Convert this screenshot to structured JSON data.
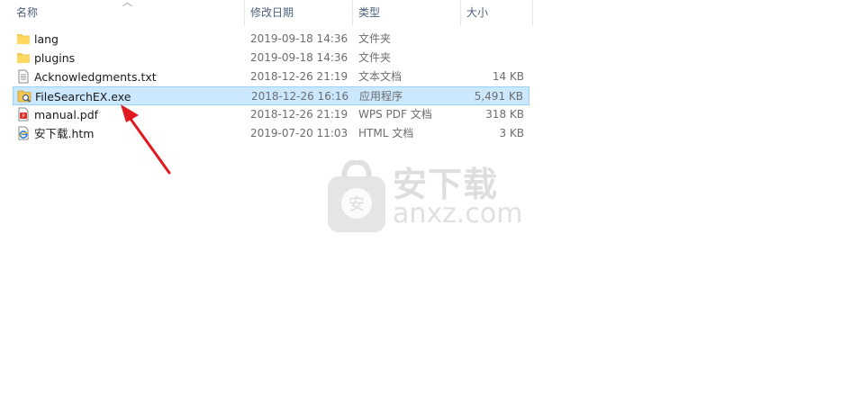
{
  "columns": {
    "name": "名称",
    "date": "修改日期",
    "type": "类型",
    "size": "大小"
  },
  "files": [
    {
      "name": "lang",
      "date": "2019-09-18 14:36",
      "type": "文件夹",
      "size": "",
      "icon": "folder-icon"
    },
    {
      "name": "plugins",
      "date": "2019-09-18 14:36",
      "type": "文件夹",
      "size": "",
      "icon": "folder-icon"
    },
    {
      "name": "Acknowledgments.txt",
      "date": "2018-12-26 21:19",
      "type": "文本文档",
      "size": "14 KB",
      "icon": "text-file-icon"
    },
    {
      "name": "FileSearchEX.exe",
      "date": "2018-12-26 16:16",
      "type": "应用程序",
      "size": "5,491 KB",
      "icon": "app-icon"
    },
    {
      "name": "manual.pdf",
      "date": "2018-12-26 21:19",
      "type": "WPS PDF 文档",
      "size": "318 KB",
      "icon": "pdf-icon"
    },
    {
      "name": "安下载.htm",
      "date": "2019-07-20 11:03",
      "type": "HTML 文档",
      "size": "3 KB",
      "icon": "html-file-icon"
    }
  ],
  "selected_index": 3,
  "watermark": {
    "text_cn": "安下载",
    "text_en": "anxz.com",
    "badge": "安"
  },
  "colors": {
    "selection_bg": "#cce8ff",
    "selection_border": "#99d1ff",
    "header_text": "#4c607a",
    "arrow": "#e0191e"
  }
}
